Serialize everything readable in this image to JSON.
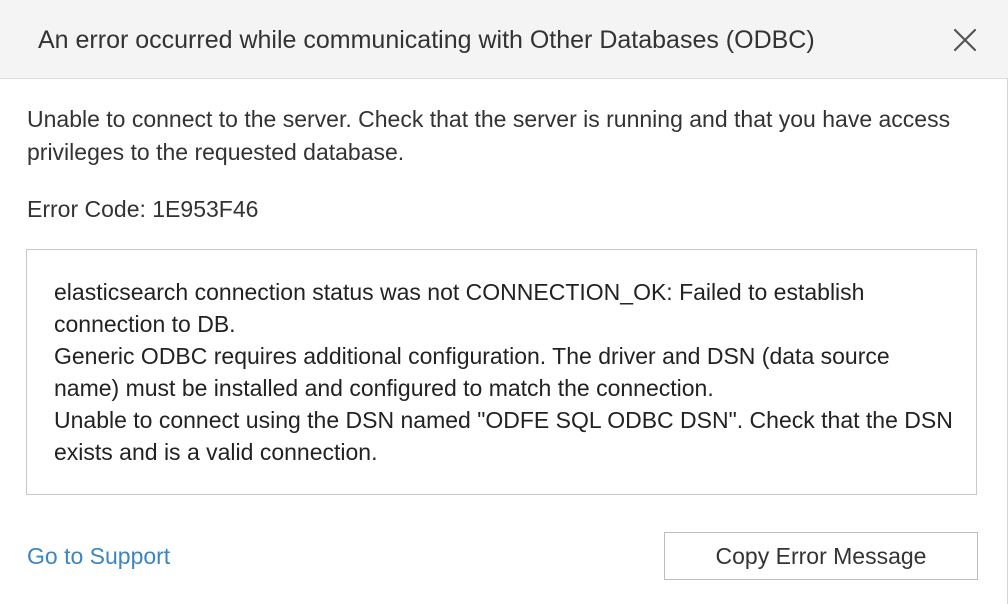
{
  "dialog": {
    "title": "An error occurred while communicating with Other Databases (ODBC)",
    "close_icon": "close-icon",
    "message": "Unable to connect to the server. Check that the server is running and that you have access privileges to the requested database.",
    "error_code": "Error Code: 1E953F46",
    "details": [
      "elasticsearch connection status was not CONNECTION_OK: Failed to establish connection to DB.",
      "Generic ODBC requires additional configuration. The driver and DSN (data source name) must be installed and configured to match the connection.",
      "Unable to connect using the DSN named \"ODFE SQL ODBC DSN\". Check that the DSN exists and is a valid connection."
    ],
    "support_link": "Go to Support",
    "copy_button": "Copy Error Message"
  },
  "colors": {
    "header_bg": "#f4f4f4",
    "link": "#3a86c4",
    "text": "#333333",
    "border": "#c8c8c8"
  }
}
